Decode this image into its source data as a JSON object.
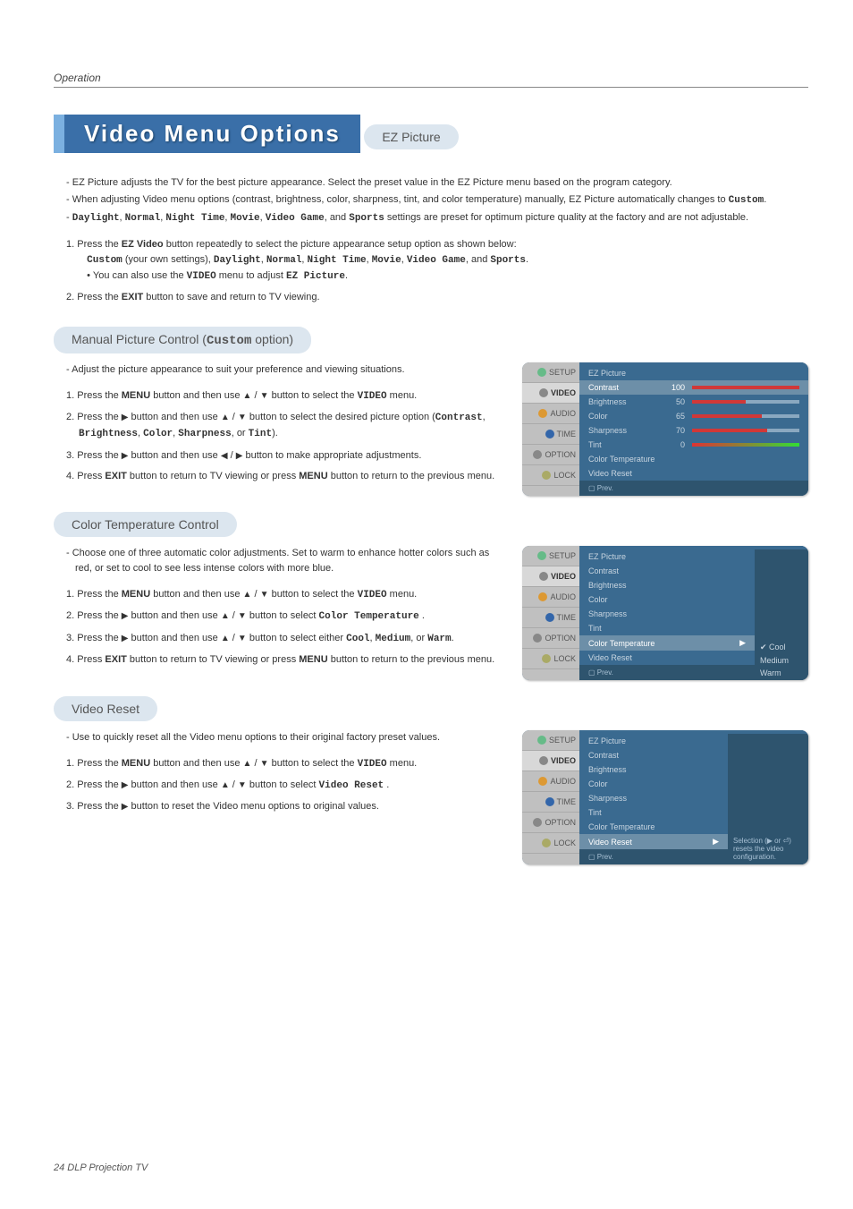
{
  "header": {
    "section": "Operation"
  },
  "title": "Video Menu Options",
  "sections": {
    "ez": {
      "heading": "EZ Picture",
      "bullets": [
        "EZ Picture adjusts the TV for the best picture appearance. Select the preset value in the EZ Picture menu based on the program category.",
        "When adjusting Video menu options (contrast, brightness, color, sharpness, tint, and color temperature) manually, EZ Picture automatically changes to Custom.",
        "Daylight, Normal, Night Time, Movie, Video Game, and Sports settings are preset for optimum picture quality at the factory and are not adjustable."
      ],
      "steps": [
        "Press the EZ Video button repeatedly to select the picture appearance setup option as shown below: Custom (your own settings), Daylight, Normal, Night Time, Movie, Video Game, and Sports.",
        "• You can also use the VIDEO menu to adjust EZ Picture.",
        "Press the EXIT button to save and return to TV viewing."
      ]
    },
    "manual": {
      "heading_prefix": "Manual Picture Control (",
      "heading_bold": "Custom",
      "heading_suffix": " option)",
      "bullets": [
        "Adjust the picture appearance to suit your preference and viewing situations."
      ],
      "steps": [
        "Press the MENU button and then use ▲ / ▼ button to select the VIDEO menu.",
        "Press the ▶ button and then use ▲ / ▼ button to select the desired picture option (Contrast, Brightness, Color, Sharpness, or Tint).",
        "Press the ▶ button and then use ◀ / ▶ button to make appropriate adjustments.",
        "Press EXIT button to return to TV viewing or press MENU button to return to the previous menu."
      ]
    },
    "color": {
      "heading": "Color Temperature Control",
      "bullets": [
        "Choose one of three automatic color adjustments. Set to warm to enhance hotter colors such as red, or set to cool to see less intense colors with more blue."
      ],
      "steps": [
        "Press the MENU button and then use ▲ / ▼ button to select the VIDEO menu.",
        "Press the ▶ button and then use ▲ / ▼ button to select Color Temperature .",
        "Press the ▶ button and then use ▲ / ▼ button to select either Cool, Medium, or Warm.",
        "Press EXIT button to return to TV viewing or press MENU button to return to the previous menu."
      ]
    },
    "reset": {
      "heading": "Video Reset",
      "bullets": [
        "Use to quickly reset all the Video menu options to their original factory preset values."
      ],
      "steps": [
        "Press the MENU button and then use ▲ / ▼ button to select the VIDEO menu.",
        "Press the ▶ button and then use ▲ / ▼ button to select Video Reset .",
        "Press the ▶ button to reset the Video menu options to original values."
      ]
    }
  },
  "osd_tabs": [
    "SETUP",
    "VIDEO",
    "AUDIO",
    "TIME",
    "OPTION",
    "LOCK"
  ],
  "osd1": {
    "rows": [
      {
        "label": "EZ Picture",
        "val": "",
        "fill": 0,
        "selected": false,
        "bar": false
      },
      {
        "label": "Contrast",
        "val": "100",
        "fill": 100,
        "selected": true,
        "bar": true
      },
      {
        "label": "Brightness",
        "val": "50",
        "fill": 50,
        "selected": false,
        "bar": true
      },
      {
        "label": "Color",
        "val": "65",
        "fill": 65,
        "selected": false,
        "bar": true
      },
      {
        "label": "Sharpness",
        "val": "70",
        "fill": 70,
        "selected": false,
        "bar": true
      },
      {
        "label": "Tint",
        "val": "0",
        "fill": 50,
        "selected": false,
        "bar": true,
        "tint": true
      },
      {
        "label": "Color Temperature",
        "val": "",
        "fill": 0,
        "selected": false,
        "bar": false
      },
      {
        "label": "Video Reset",
        "val": "",
        "fill": 0,
        "selected": false,
        "bar": false
      }
    ],
    "footer": "▢ Prev."
  },
  "osd2": {
    "rows": [
      {
        "label": "EZ Picture"
      },
      {
        "label": "Contrast"
      },
      {
        "label": "Brightness"
      },
      {
        "label": "Color"
      },
      {
        "label": "Sharpness"
      },
      {
        "label": "Tint"
      },
      {
        "label": "Color Temperature",
        "selected": true,
        "arrow": "▶"
      },
      {
        "label": "Video Reset"
      }
    ],
    "side": [
      "✔ Cool",
      "Medium",
      "Warm"
    ],
    "footer": "▢ Prev."
  },
  "osd3": {
    "rows": [
      {
        "label": "EZ Picture"
      },
      {
        "label": "Contrast"
      },
      {
        "label": "Brightness"
      },
      {
        "label": "Color"
      },
      {
        "label": "Sharpness"
      },
      {
        "label": "Tint"
      },
      {
        "label": "Color Temperature"
      },
      {
        "label": "Video Reset",
        "selected": true,
        "arrow": "▶"
      }
    ],
    "side_msg": "Selection (▶ or ⏎) resets the video configuration.",
    "footer": "▢ Prev."
  },
  "footer": "24  DLP Projection TV"
}
